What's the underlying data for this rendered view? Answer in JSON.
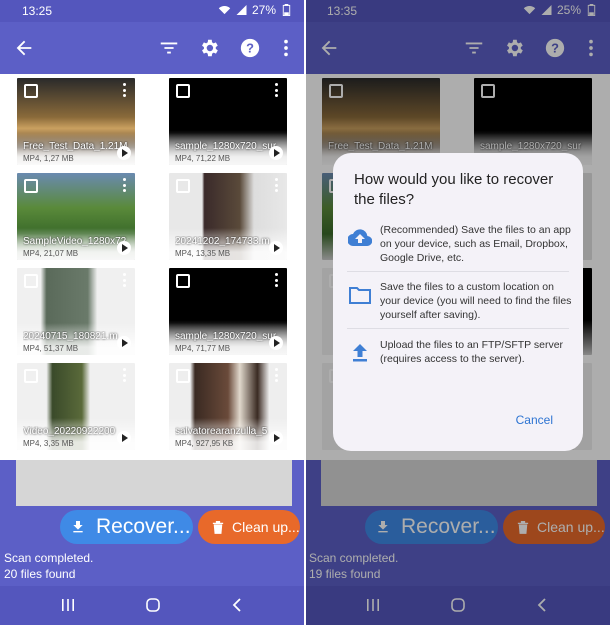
{
  "left": {
    "status_time": "13:25",
    "battery": "27%",
    "files": [
      {
        "name": "Free_Test_Data_1.21M",
        "meta": "MP4, 1,27 MB"
      },
      {
        "name": "sample_1280x720_sur",
        "meta": "MP4, 71,22 MB"
      },
      {
        "name": "SampleVideo_1280x72",
        "meta": "MP4, 21,07 MB"
      },
      {
        "name": "20241202_174733.m",
        "meta": "MP4, 13,35 MB"
      },
      {
        "name": "20240715_180821.m",
        "meta": "MP4, 51,37 MB"
      },
      {
        "name": "sample_1280x720_sur",
        "meta": "MP4, 71,77 MB"
      },
      {
        "name": "Video_20220922200",
        "meta": "MP4, 3,35 MB"
      },
      {
        "name": "salvatorearanzulla_5",
        "meta": "MP4, 927,95 KB"
      }
    ],
    "recover_label": "Recover...",
    "clean_label": "Clean up...",
    "scan_status": "Scan completed.",
    "files_found": "20 files found"
  },
  "right": {
    "status_time": "13:35",
    "battery": "25%",
    "files": [
      {
        "name": "Free_Test_Data_1.21M"
      },
      {
        "name": "sample_1280x720_sur"
      }
    ],
    "recover_label": "Recover...",
    "clean_label": "Clean up...",
    "scan_status": "Scan completed.",
    "files_found": "19 files found"
  },
  "dialog": {
    "title": "How would you like to recover the files?",
    "options": [
      {
        "icon": "cloud-upload-icon",
        "text": "(Recommended) Save the files to an app on your device, such as Email, Dropbox, Google Drive, etc."
      },
      {
        "icon": "folder-icon",
        "text": "Save the files to a custom location on your device (you will need to find the files yourself after saving)."
      },
      {
        "icon": "upload-icon",
        "text": "Upload the files to an FTP/SFTP server (requires access to the server)."
      }
    ],
    "cancel_label": "Cancel"
  },
  "colors": {
    "app_bar": "#5c5fc6",
    "recover_button": "#3f8ae6",
    "clean_button": "#e8692a",
    "dialog_accent": "#2d74d2"
  }
}
